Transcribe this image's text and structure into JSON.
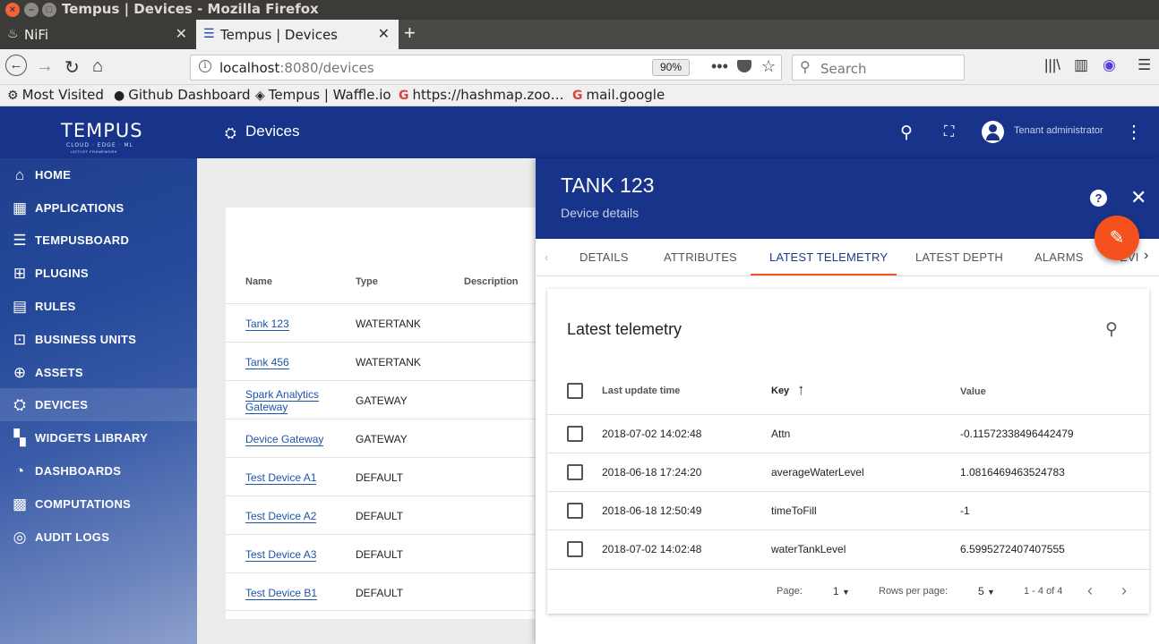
{
  "window": {
    "title": "Tempus | Devices - Mozilla Firefox"
  },
  "browser": {
    "tabs": [
      {
        "label": "NiFi",
        "icon": "nifi-icon"
      },
      {
        "label": "Tempus | Devices",
        "icon": "tempus-icon",
        "active": true
      }
    ],
    "url": {
      "host": "localhost",
      "path": ":8080/devices"
    },
    "zoom": "90%",
    "search_placeholder": "Search",
    "bookmarks": [
      {
        "label": "Most Visited",
        "icon": "gear-icon"
      },
      {
        "label": "Github Dashboard",
        "icon": "github-icon"
      },
      {
        "label": "Tempus | Waffle.io",
        "icon": "waffle-icon"
      },
      {
        "label": "https://hashmap.zoo…",
        "icon": "google-icon"
      },
      {
        "label": "mail.google",
        "icon": "google-icon"
      }
    ]
  },
  "app": {
    "logo": {
      "name": "TEMPUS",
      "tagline": "CLOUD · EDGE · ML",
      "sub": "IIOT/IOT FRAMEWORK"
    },
    "sidebar": [
      {
        "label": "HOME",
        "icon": "home-icon"
      },
      {
        "label": "APPLICATIONS",
        "icon": "apps-grid-icon"
      },
      {
        "label": "TEMPUSBOARD",
        "icon": "tempusboard-icon"
      },
      {
        "label": "PLUGINS",
        "icon": "plugin-icon"
      },
      {
        "label": "RULES",
        "icon": "rules-icon"
      },
      {
        "label": "BUSINESS UNITS",
        "icon": "business-units-icon"
      },
      {
        "label": "ASSETS",
        "icon": "assets-icon"
      },
      {
        "label": "DEVICES",
        "icon": "devices-icon",
        "active": true
      },
      {
        "label": "WIDGETS LIBRARY",
        "icon": "widgets-icon"
      },
      {
        "label": "DASHBOARDS",
        "icon": "dashboards-icon"
      },
      {
        "label": "COMPUTATIONS",
        "icon": "computations-icon"
      },
      {
        "label": "AUDIT LOGS",
        "icon": "audit-logs-icon"
      }
    ],
    "topbar": {
      "title": "Devices",
      "user": "Tenant administrator"
    }
  },
  "device_list": {
    "columns": {
      "name": "Name",
      "type": "Type",
      "description": "Description"
    },
    "rows": [
      {
        "name": "Tank 123",
        "type": "WATERTANK"
      },
      {
        "name": "Tank 456",
        "type": "WATERTANK"
      },
      {
        "name": "Spark Analytics Gateway",
        "name_l1": "Spark Analytics",
        "name_l2": "Gateway",
        "type": "GATEWAY"
      },
      {
        "name": "Device Gateway",
        "type": "GATEWAY"
      },
      {
        "name": "Test Device A1",
        "type": "DEFAULT"
      },
      {
        "name": "Test Device A2",
        "type": "DEFAULT"
      },
      {
        "name": "Test Device A3",
        "type": "DEFAULT"
      },
      {
        "name": "Test Device B1",
        "type": "DEFAULT"
      }
    ]
  },
  "details": {
    "title": "TANK 123",
    "subtitle": "Device details",
    "tabs": [
      "DETAILS",
      "ATTRIBUTES",
      "LATEST TELEMETRY",
      "LATEST DEPTH",
      "ALARMS",
      "EVI"
    ],
    "active_tab": "LATEST TELEMETRY",
    "telemetry": {
      "title": "Latest telemetry",
      "columns": {
        "time": "Last update time",
        "key": "Key",
        "value": "Value"
      },
      "sort": {
        "column": "Key",
        "direction": "ascending"
      },
      "rows": [
        {
          "time": "2018-07-02 14:02:48",
          "key": "Attn",
          "value": "-0.11572338496442479"
        },
        {
          "time": "2018-06-18 17:24:20",
          "key": "averageWaterLevel",
          "value": "1.0816469463524783"
        },
        {
          "time": "2018-06-18 12:50:49",
          "key": "timeToFill",
          "value": "-1"
        },
        {
          "time": "2018-07-02 14:02:48",
          "key": "waterTankLevel",
          "value": "6.5995272407407555"
        }
      ],
      "footer": {
        "page_label": "Page:",
        "page": "1",
        "rows_label": "Rows per page:",
        "rows_per_page": "5",
        "range": "1 - 4 of 4"
      }
    }
  },
  "colors": {
    "primary": "#17338a",
    "accent": "#f4511e",
    "link": "#1c54a8"
  }
}
